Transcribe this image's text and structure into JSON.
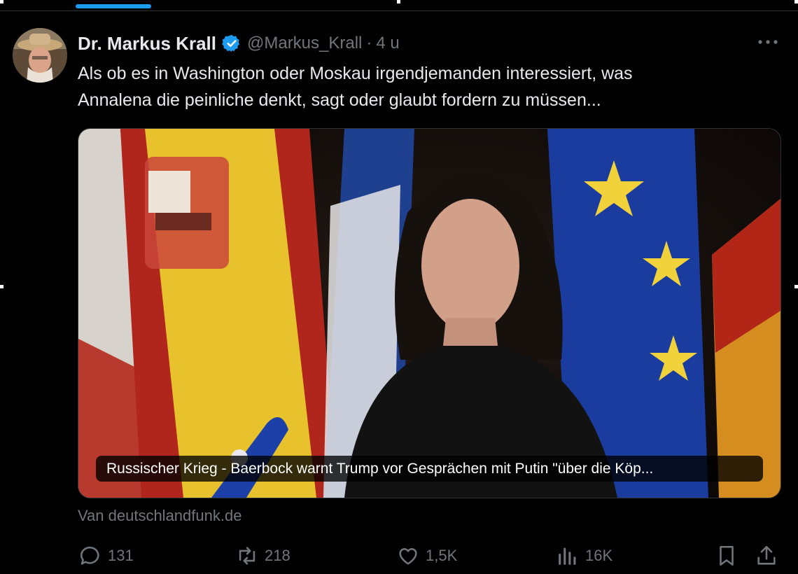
{
  "author": {
    "display_name": "Dr. Markus Krall",
    "handle": "@Markus_Krall",
    "separator": "·",
    "time": "4 u",
    "verified": true,
    "avatar_icon": "avatar-photo"
  },
  "tweet": {
    "text_line_1": "Als ob es in Washington oder Moskau irgendjemanden interessiert, was",
    "text_line_2": "Annalena die peinliche denkt, sagt oder glaubt fordern zu müssen..."
  },
  "card": {
    "caption": "Russischer Krieg - Baerbock warnt Trump vor Gesprächen mit Putin \"über die Köp...",
    "source": "Van deutschlandfunk.de"
  },
  "actions": {
    "replies": "131",
    "reposts": "218",
    "likes": "1,5K",
    "views": "16K",
    "icons": [
      "reply-icon",
      "repost-icon",
      "like-icon",
      "views-icon",
      "bookmark-icon",
      "share-icon"
    ]
  },
  "colors": {
    "background": "#000000",
    "text": "#e7e9ea",
    "secondary": "#71767b",
    "accent": "#1d9bf0",
    "border": "#2f3336"
  }
}
